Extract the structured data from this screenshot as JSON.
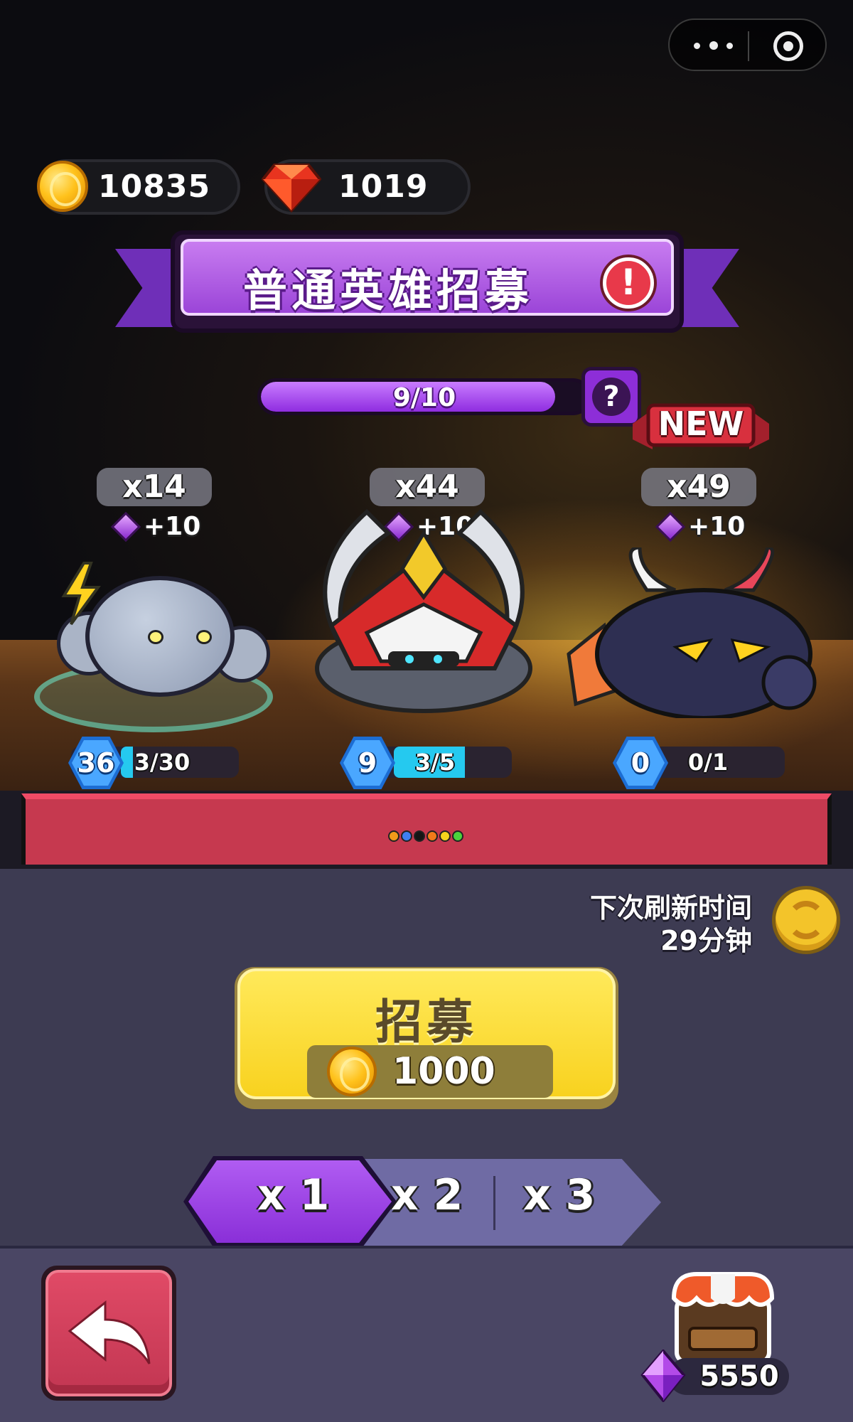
{
  "resources": {
    "coins": "10835",
    "gems_red": "1019",
    "gems_purple": "5550"
  },
  "banner": {
    "title": "普通英雄招募",
    "alert": "!"
  },
  "progress": {
    "text": "9/10",
    "fraction": 0.9,
    "help": "?"
  },
  "new_badge": "NEW",
  "heroes": [
    {
      "count": "x14",
      "gem_bonus": "+10",
      "level": "36",
      "progress_text": "3/30",
      "fraction": 0.1,
      "icon": "storm-cloud-hero"
    },
    {
      "count": "x44",
      "gem_bonus": "+10",
      "level": "9",
      "progress_text": "3/5",
      "fraction": 0.6,
      "icon": "red-armored-knight-hero"
    },
    {
      "count": "x49",
      "gem_bonus": "+10",
      "level": "0",
      "progress_text": "0/1",
      "fraction": 0,
      "icon": "horned-demon-hero"
    }
  ],
  "page_dots": [
    "#f39a1a",
    "#3f7ff0",
    "#151515",
    "#f27a1a",
    "#f5d31c",
    "#4bd23c"
  ],
  "refresh": {
    "label": "下次刷新时间",
    "time": "29分钟"
  },
  "recruit": {
    "label": "招募",
    "cost": "1000"
  },
  "multipliers": [
    "x 1",
    "x 2",
    "x 3"
  ],
  "selected_multiplier": "x 1",
  "colors": {
    "accent_purple": "#9b45d8",
    "recruit_yellow": "#f8d21f",
    "back_red": "#c23652",
    "panel": "#3d3b52"
  }
}
